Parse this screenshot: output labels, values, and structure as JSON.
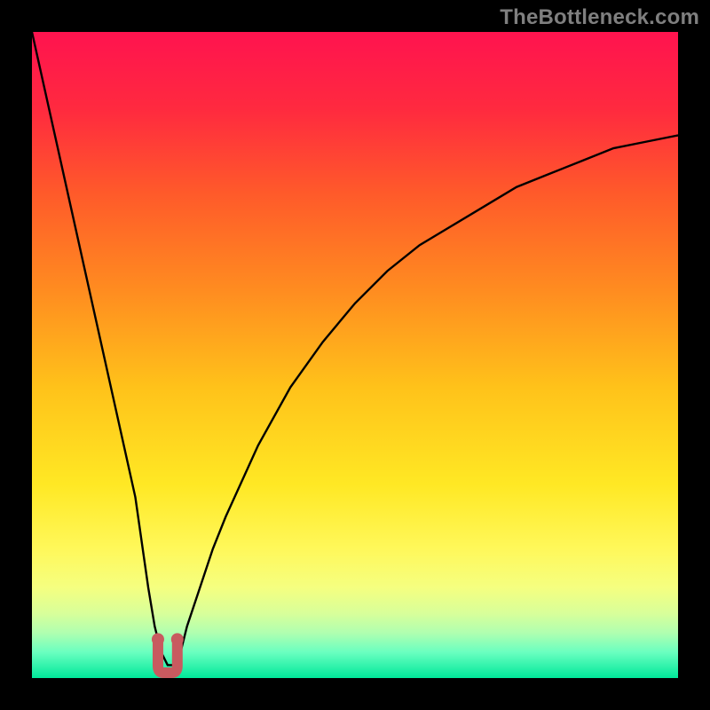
{
  "watermark": "TheBottleneck.com",
  "chart_data": {
    "type": "line",
    "title": "",
    "xlabel": "",
    "ylabel": "",
    "xlim": [
      0,
      100
    ],
    "ylim": [
      0,
      100
    ],
    "series": [
      {
        "name": "bottleneck-curve",
        "x": [
          0,
          2,
          4,
          6,
          8,
          10,
          12,
          14,
          16,
          18,
          19,
          20,
          21,
          22,
          23,
          24,
          26,
          28,
          30,
          35,
          40,
          45,
          50,
          55,
          60,
          65,
          70,
          75,
          80,
          85,
          90,
          95,
          100
        ],
        "y": [
          100,
          91,
          82,
          73,
          64,
          55,
          46,
          37,
          28,
          14,
          8,
          4,
          2,
          2,
          4,
          8,
          14,
          20,
          25,
          36,
          45,
          52,
          58,
          63,
          67,
          70,
          73,
          76,
          78,
          80,
          82,
          83,
          84
        ]
      }
    ],
    "markers": [
      {
        "x": 19.5,
        "y": 6,
        "name": "left-notch-point"
      },
      {
        "x": 22.5,
        "y": 6,
        "name": "right-notch-point"
      }
    ],
    "marker_color": "#c85a5f",
    "curve_color": "#000000",
    "gradient_stops": [
      {
        "offset": 0.0,
        "color": "#ff134f"
      },
      {
        "offset": 0.12,
        "color": "#ff2a3f"
      },
      {
        "offset": 0.25,
        "color": "#ff5a2a"
      },
      {
        "offset": 0.4,
        "color": "#ff8c20"
      },
      {
        "offset": 0.55,
        "color": "#ffc21a"
      },
      {
        "offset": 0.7,
        "color": "#ffe824"
      },
      {
        "offset": 0.8,
        "color": "#fff85a"
      },
      {
        "offset": 0.86,
        "color": "#f5ff80"
      },
      {
        "offset": 0.9,
        "color": "#d8ff9a"
      },
      {
        "offset": 0.93,
        "color": "#b0ffb0"
      },
      {
        "offset": 0.96,
        "color": "#6affc0"
      },
      {
        "offset": 1.0,
        "color": "#00e89a"
      }
    ],
    "notch": {
      "color": "#c85a5f",
      "x_range": [
        19.5,
        22.5
      ],
      "depth": 6
    }
  }
}
